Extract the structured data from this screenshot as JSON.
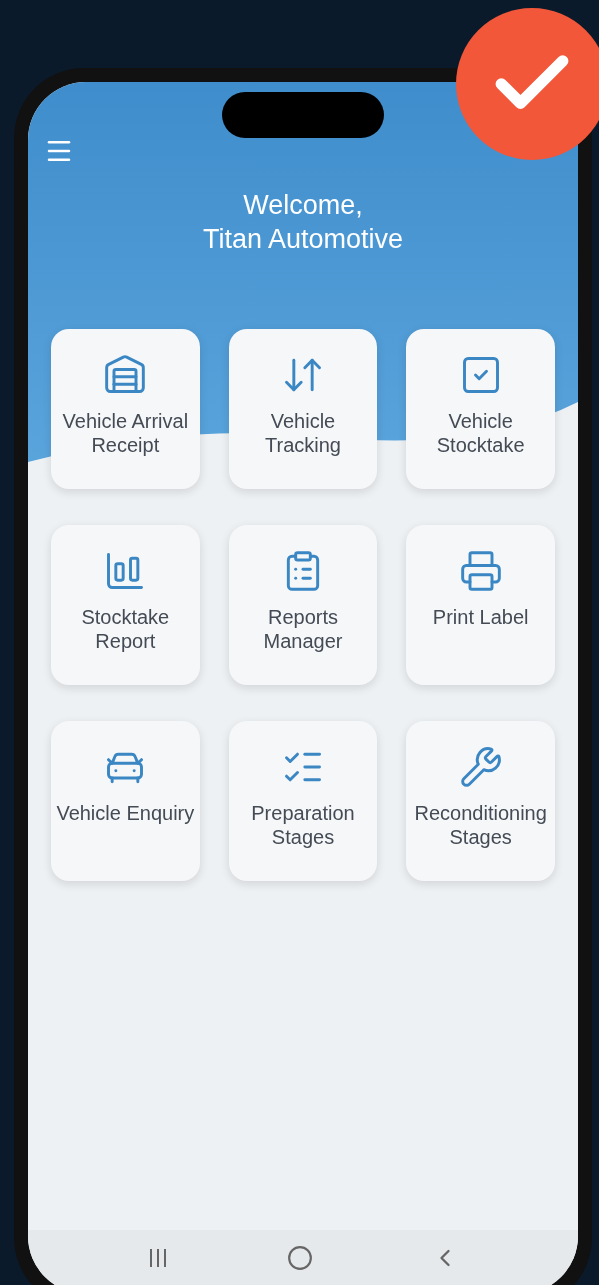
{
  "header": {
    "greeting": "Welcome,",
    "company": "Titan Automotive"
  },
  "tiles": [
    {
      "label": "Vehicle Arrival Receipt"
    },
    {
      "label": "Vehicle Tracking"
    },
    {
      "label": "Vehicle Stocktake"
    },
    {
      "label": "Stocktake Report"
    },
    {
      "label": "Reports Manager"
    },
    {
      "label": "Print Label"
    },
    {
      "label": "Vehicle Enquiry"
    },
    {
      "label": "Preparation Stages"
    },
    {
      "label": "Reconditioning Stages"
    }
  ]
}
